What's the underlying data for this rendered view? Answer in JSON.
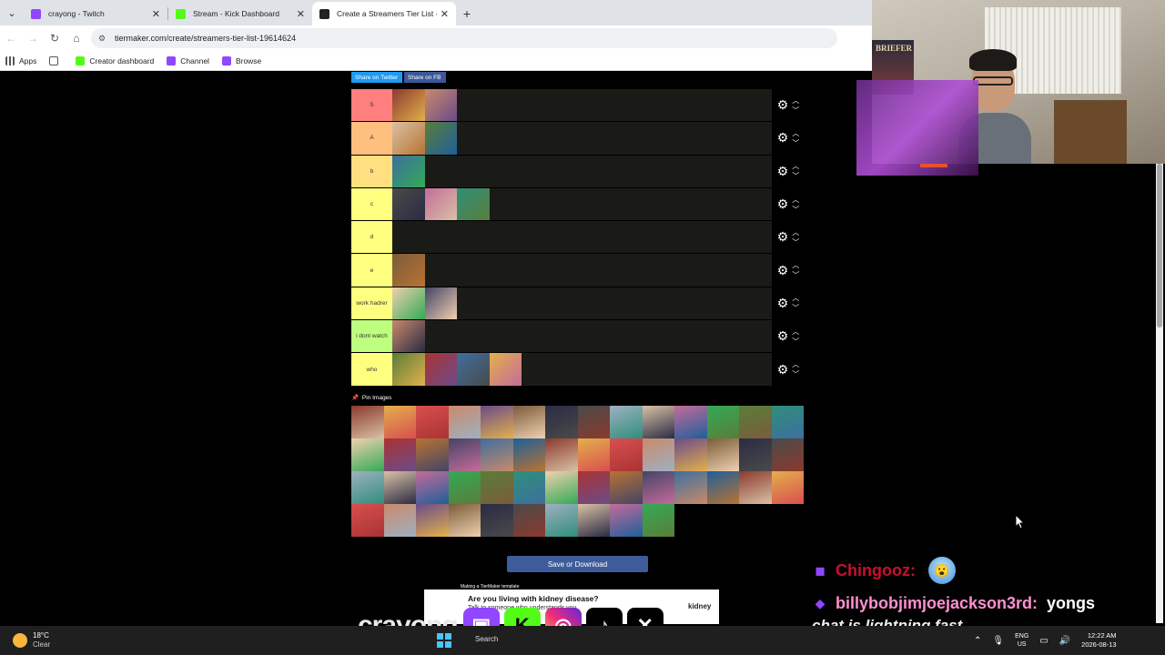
{
  "browser": {
    "tabs": [
      {
        "title": "crayong - Twitch",
        "color": "#9146ff",
        "active": false
      },
      {
        "title": "Stream - Kick Dashboard",
        "color": "#53fc18",
        "active": false
      },
      {
        "title": "Create a Streamers Tier List - Ti",
        "color": "#222222",
        "active": true
      }
    ],
    "url": "tiermaker.com/create/streamers-tier-list-19614624",
    "bookmarks": [
      {
        "label": "Apps"
      },
      {
        "label": "Creator dashboard"
      },
      {
        "label": "Channel"
      },
      {
        "label": "Browse"
      }
    ]
  },
  "page": {
    "share_twitter": "Share on Twitter",
    "share_fb": "Share on FB",
    "tiers": [
      {
        "label": "S",
        "color": "#ff7f7f",
        "items": 2
      },
      {
        "label": "A",
        "color": "#ffbf7f",
        "items": 2
      },
      {
        "label": "b",
        "color": "#ffdf7f",
        "items": 1
      },
      {
        "label": "c",
        "color": "#ffff7f",
        "items": 3
      },
      {
        "label": "d",
        "color": "#ffff7f",
        "items": 0
      },
      {
        "label": "e",
        "color": "#ffff7f",
        "items": 1
      },
      {
        "label": "work hadrer",
        "color": "#ffff7f",
        "items": 2
      },
      {
        "label": "i dont watch",
        "color": "#bfff7f",
        "items": 1
      },
      {
        "label": "who",
        "color": "#ffff7f",
        "items": 4
      }
    ],
    "pin_images": "Pin Images",
    "pool_count": 52,
    "save_button": "Save or Download"
  },
  "overlay": {
    "cam_poster_text": "BRIEFER",
    "chat": {
      "user1": "Chingooz:",
      "user2": "billybobjimjoejackson3rd:",
      "message2": "yongs",
      "line3": "chat is lightning fast"
    },
    "brand": "crayong",
    "ad": {
      "caption": "Making a TierMaker template",
      "title": "Are you living with kidney disease?",
      "subtitle": "Talk to someone who understands you.",
      "logo": "kidney"
    }
  },
  "taskbar": {
    "temperature": "18°C",
    "condition": "Clear",
    "search": "Search",
    "lang_top": "ENG",
    "lang_bottom": "US",
    "time": "12:22 AM",
    "date": "2026-08-13"
  },
  "colors": {
    "twitch": "#9146ff",
    "kick": "#53fc18",
    "save_button": "#3e5c9a"
  }
}
